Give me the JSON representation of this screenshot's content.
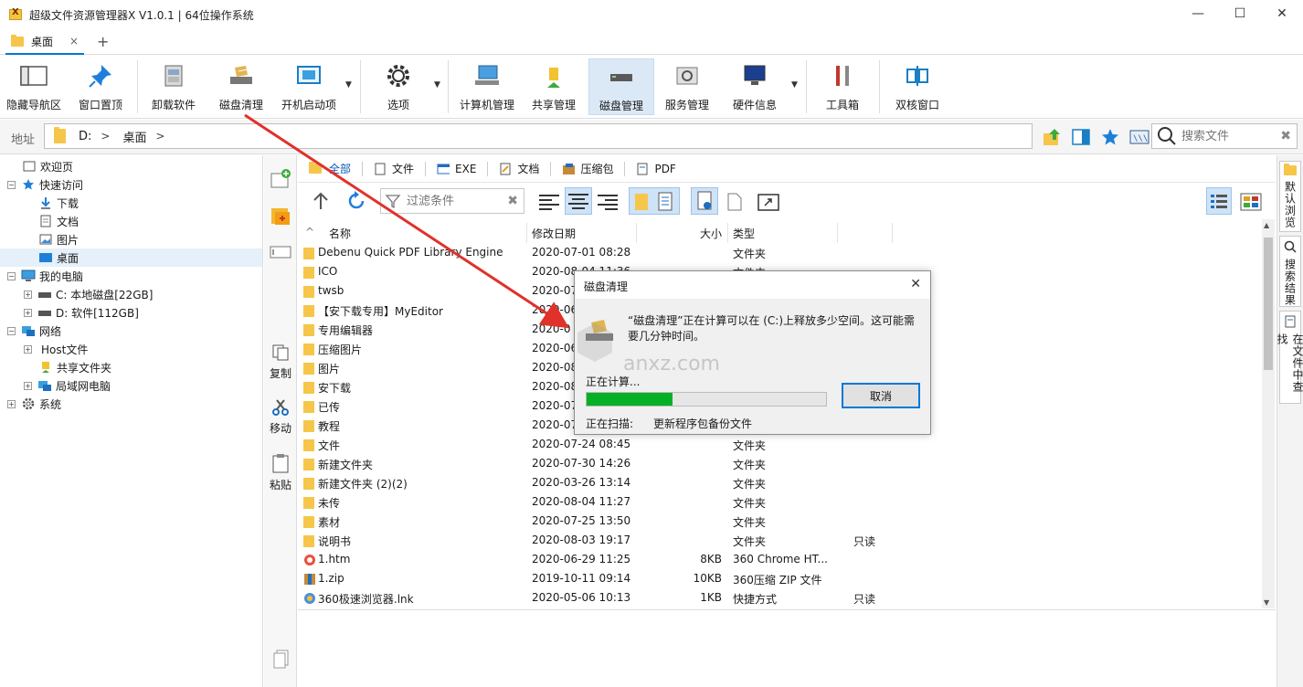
{
  "window": {
    "title": "超级文件资源管理器X V1.0.1 | 64位操作系统",
    "minimize": "—",
    "maximize": "☐",
    "close": "✕"
  },
  "tabs": {
    "active_label": "桌面",
    "close": "×",
    "add": "+"
  },
  "ribbon": {
    "hide_nav": "隐藏导航区",
    "pin_window": "窗口置顶",
    "uninstall": "卸载软件",
    "disk_clean": "磁盘清理",
    "startup": "开机启动项",
    "options": "选项",
    "computer_mgmt": "计算机管理",
    "share_mgmt": "共享管理",
    "disk_mgmt": "磁盘管理",
    "service_mgmt": "服务管理",
    "hardware": "硬件信息",
    "toolbox": "工具箱",
    "dual_window": "双核窗口"
  },
  "address": {
    "label": "地址",
    "drive": "D:",
    "sep1": ">",
    "folder": "桌面",
    "sep2": ">",
    "search_placeholder": "搜索文件"
  },
  "tree": {
    "welcome": "欢迎页",
    "quick_access": "快速访问",
    "downloads": "下载",
    "documents": "文档",
    "pictures": "图片",
    "desktop": "桌面",
    "my_computer": "我的电脑",
    "drive_c": "C: 本地磁盘[22GB]",
    "drive_d": "D: 软件[112GB]",
    "network": "网络",
    "host_file": "Host文件",
    "shared_folder": "共享文件夹",
    "lan": "局域网电脑",
    "system": "系统"
  },
  "side_actions": {
    "copy": "复制",
    "move": "移动",
    "paste": "粘贴"
  },
  "filter_tabs": {
    "all": "全部",
    "file": "文件",
    "exe": "EXE",
    "doc": "文档",
    "zip": "压缩包",
    "pdf": "PDF"
  },
  "file_toolbar": {
    "filter_placeholder": "过滤条件"
  },
  "columns": {
    "name": "名称",
    "date": "修改日期",
    "size": "大小",
    "type": "类型"
  },
  "files": [
    {
      "name": "Debenu Quick PDF Library Engine",
      "date": "2020-07-01 08:28",
      "size": "",
      "type": "文件夹",
      "attr": ""
    },
    {
      "name": "ICO",
      "date": "2020-08-04 11:36",
      "size": "",
      "type": "文件夹",
      "attr": ""
    },
    {
      "name": "twsb",
      "date": "2020-07-",
      "size": "",
      "type": "",
      "attr": ""
    },
    {
      "name": "【安下载专用】MyEditor",
      "date": "2020-06-",
      "size": "",
      "type": "",
      "attr": ""
    },
    {
      "name": "专用编辑器",
      "date": "2020-0",
      "size": "",
      "type": "",
      "attr": ""
    },
    {
      "name": "压缩图片",
      "date": "2020-06-",
      "size": "",
      "type": "",
      "attr": ""
    },
    {
      "name": "图片",
      "date": "2020-08-",
      "size": "",
      "type": "",
      "attr": ""
    },
    {
      "name": "安下载",
      "date": "2020-08-",
      "size": "",
      "type": "",
      "attr": ""
    },
    {
      "name": "已传",
      "date": "2020-07-",
      "size": "",
      "type": "",
      "attr": ""
    },
    {
      "name": "教程",
      "date": "2020-07-",
      "size": "",
      "type": "",
      "attr": ""
    },
    {
      "name": "文件",
      "date": "2020-07-24 08:45",
      "size": "",
      "type": "文件夹",
      "attr": ""
    },
    {
      "name": "新建文件夹",
      "date": "2020-07-30 14:26",
      "size": "",
      "type": "文件夹",
      "attr": ""
    },
    {
      "name": "新建文件夹 (2)(2)",
      "date": "2020-03-26 13:14",
      "size": "",
      "type": "文件夹",
      "attr": ""
    },
    {
      "name": "未传",
      "date": "2020-08-04 11:27",
      "size": "",
      "type": "文件夹",
      "attr": ""
    },
    {
      "name": "素材",
      "date": "2020-07-25 13:50",
      "size": "",
      "type": "文件夹",
      "attr": ""
    },
    {
      "name": "说明书",
      "date": "2020-08-03 19:17",
      "size": "",
      "type": "文件夹",
      "attr": "只读"
    },
    {
      "name": "1.htm",
      "date": "2020-06-29 11:25",
      "size": "8KB",
      "type": "360 Chrome HT...",
      "attr": ""
    },
    {
      "name": "1.zip",
      "date": "2019-10-11 09:14",
      "size": "10KB",
      "type": "360压缩 ZIP 文件",
      "attr": ""
    },
    {
      "name": "360极速浏览器.lnk",
      "date": "2020-05-06 10:13",
      "size": "1KB",
      "type": "快捷方式",
      "attr": "只读"
    }
  ],
  "right_tabs": {
    "default_browse": "默认浏览",
    "search_results": "搜索结果",
    "find_in_file": "在文件中查找"
  },
  "dialog": {
    "title": "磁盘清理",
    "close": "✕",
    "message": "“磁盘清理”正在计算可以在 (C:)上释放多少空间。这可能需要几分钟时间。",
    "calculating": "正在计算...",
    "progress": 0.36,
    "cancel": "取消",
    "scanning_label": "正在扫描:",
    "scanning_value": "更新程序包备份文件"
  },
  "watermark": {
    "text": "anxz.com"
  },
  "colors": {
    "accent": "#0078d7",
    "progress": "#06b025",
    "folder": "#f6c64a",
    "arrow": "#e0312b"
  }
}
